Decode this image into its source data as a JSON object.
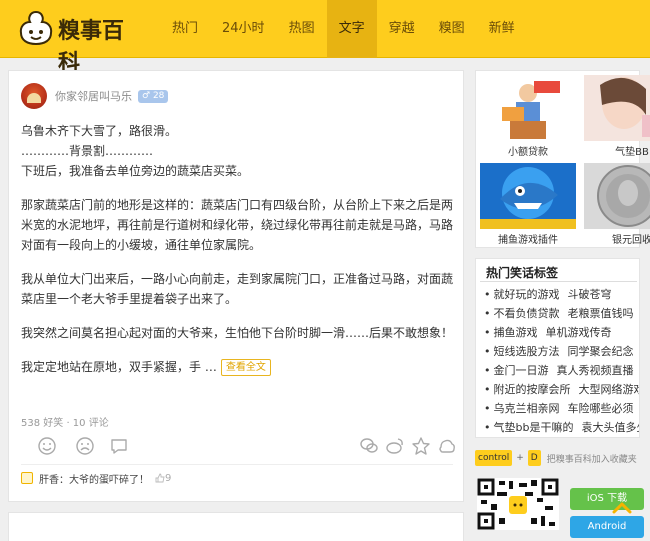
{
  "header": {
    "logo_text": "糗事百科",
    "nav": [
      "热门",
      "24小时",
      "热图",
      "文字",
      "穿越",
      "糗图",
      "新鲜"
    ],
    "active_index": 3
  },
  "post": {
    "author": "你家邻居叫马乐",
    "age": "28",
    "paragraphs": [
      [
        "乌鲁木齐下大雪了，路很滑。",
        "…………背景割…………",
        "下班后，我准备去单位旁边的蔬菜店买菜。"
      ],
      [
        "那家蔬菜店门前的地形是这样的：蔬菜店门口有四级台阶，从台阶上下来之后是两米宽的水泥地坪，再往前是行道树和绿化带，绕过绿化带再往前走就是马路，马路对面有一段向上的小缓坡，通往单位家属院。"
      ],
      [
        "我从单位大门出来后，一路小心向前走，走到家属院门口，正准备过马路，对面蔬菜店里一个老大爷手里提着袋子出来了。"
      ],
      [
        "我突然之间莫名担心起对面的大爷来，生怕他下台阶时脚一滑……后果不敢想象！"
      ]
    ],
    "last_line": "我定定地站在原地，双手紧握，手 …",
    "more_label": "查看全文",
    "stats": "538 好笑 · 10 评论",
    "hot_comment": "肝香：大爷的蛋吓碎了！",
    "hot_comment_likes": "9"
  },
  "sidebar": {
    "ads": [
      {
        "caption": "小额贷款"
      },
      {
        "caption": "气垫BB"
      },
      {
        "caption": "捕鱼游戏插件"
      },
      {
        "caption": "银元回收"
      }
    ],
    "tags_title": "热门笑话标签",
    "tags": [
      [
        "就好玩的游戏",
        "斗破苍穹"
      ],
      [
        "不看负债贷款",
        "老粮票值钱吗"
      ],
      [
        "捕鱼游戏",
        "单机游戏传奇"
      ],
      [
        "短线选股方法",
        "同学聚会纪念"
      ],
      [
        "金门一日游",
        "真人秀视频直播"
      ],
      [
        "附近的按摩会所",
        "大型网络游戏"
      ],
      [
        "乌克兰相亲网",
        "车险哪些必须"
      ],
      [
        "气垫bb是干嘛的",
        "袁大头值多少"
      ]
    ],
    "bookmark": {
      "key1": "control",
      "plus": "+",
      "key2": "D",
      "text": "把糗事百科加入收藏夹"
    },
    "ios_label": "iOS 下载",
    "android_label": "Android"
  },
  "colors": {
    "brand": "#fecd1d",
    "nav_active": "#e7b312",
    "ios": "#65c24a",
    "android": "#2ea6e6"
  }
}
